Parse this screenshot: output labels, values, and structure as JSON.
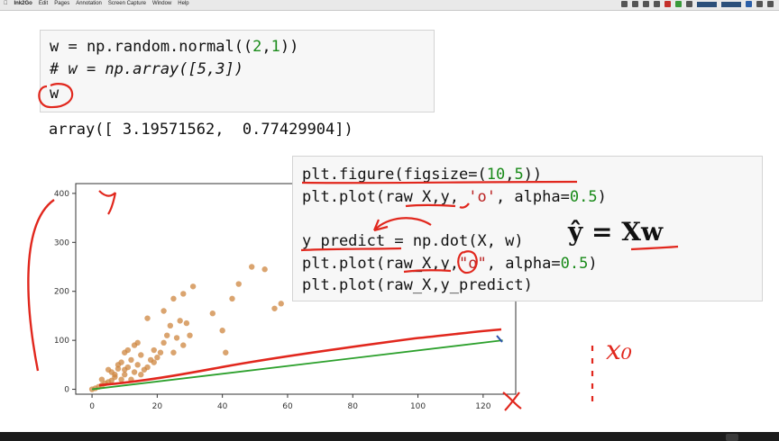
{
  "menubar": {
    "app_name": "Ink2Go",
    "items": [
      "Edit",
      "Pages",
      "Annotation",
      "Screen Capture",
      "Window",
      "Help"
    ]
  },
  "cell1": {
    "line1_pre": "w = np.random.normal((",
    "line1_n1": "2",
    "line1_mid": ",",
    "line1_n2": "1",
    "line1_post": "))",
    "line2_comment": "# w = np.array([5,3])",
    "line3": "w"
  },
  "output1": "array([ 3.19571562,  0.77429904])",
  "cell2": {
    "l1_pre": "plt.figure(figsize=(",
    "l1_n1": "10",
    "l1_mid": ",",
    "l1_n2": "5",
    "l1_post": "))",
    "l2_pre": "plt.plot(raw_X,y, ",
    "l2_str": "'o'",
    "l2_mid": ", alpha=",
    "l2_num": "0.5",
    "l2_post": ")",
    "l3_pre": "y_predict = np.dot(X, w)",
    "l4_pre": "plt.plot(raw_X,y,",
    "l4_str": "\"o\"",
    "l4_mid": ", alpha=",
    "l4_num": "0.5",
    "l4_post": ")",
    "l5": "plt.plot(raw_X,y_predict)"
  },
  "formula": "ŷ = Xw",
  "handwriting": {
    "x0": "x₀"
  },
  "colors": {
    "scatter": "#cd853f",
    "prediction_line": "#2ca02c",
    "annotation": "#e1271d",
    "number": "#1a8b1a",
    "comment": "#3d7d8c"
  },
  "chart_data": {
    "type": "scatter",
    "xlim": [
      -5,
      130
    ],
    "ylim": [
      -10,
      420
    ],
    "x_ticks": [
      0,
      20,
      40,
      60,
      80,
      100,
      120
    ],
    "y_ticks": [
      0,
      100,
      200,
      300,
      400
    ],
    "scatter_points": [
      [
        0,
        0
      ],
      [
        1,
        2
      ],
      [
        2,
        5
      ],
      [
        3,
        8
      ],
      [
        3,
        20
      ],
      [
        4,
        12
      ],
      [
        5,
        15
      ],
      [
        5,
        40
      ],
      [
        6,
        18
      ],
      [
        6,
        35
      ],
      [
        7,
        25
      ],
      [
        7,
        30
      ],
      [
        8,
        42
      ],
      [
        8,
        50
      ],
      [
        9,
        20
      ],
      [
        9,
        55
      ],
      [
        10,
        30
      ],
      [
        10,
        40
      ],
      [
        10,
        75
      ],
      [
        11,
        45
      ],
      [
        11,
        80
      ],
      [
        12,
        20
      ],
      [
        12,
        60
      ],
      [
        13,
        35
      ],
      [
        13,
        90
      ],
      [
        14,
        50
      ],
      [
        14,
        95
      ],
      [
        15,
        30
      ],
      [
        15,
        70
      ],
      [
        16,
        40
      ],
      [
        17,
        45
      ],
      [
        17,
        145
      ],
      [
        18,
        60
      ],
      [
        19,
        55
      ],
      [
        19,
        80
      ],
      [
        20,
        65
      ],
      [
        21,
        75
      ],
      [
        22,
        95
      ],
      [
        22,
        160
      ],
      [
        23,
        110
      ],
      [
        24,
        130
      ],
      [
        25,
        75
      ],
      [
        25,
        185
      ],
      [
        26,
        105
      ],
      [
        27,
        140
      ],
      [
        28,
        90
      ],
      [
        28,
        195
      ],
      [
        29,
        135
      ],
      [
        30,
        110
      ],
      [
        31,
        210
      ],
      [
        37,
        155
      ],
      [
        40,
        120
      ],
      [
        41,
        75
      ],
      [
        43,
        185
      ],
      [
        45,
        215
      ],
      [
        49,
        250
      ],
      [
        53,
        245
      ],
      [
        56,
        165
      ],
      [
        58,
        175
      ]
    ],
    "prediction_line": [
      [
        0,
        0
      ],
      [
        126,
        100
      ]
    ]
  }
}
